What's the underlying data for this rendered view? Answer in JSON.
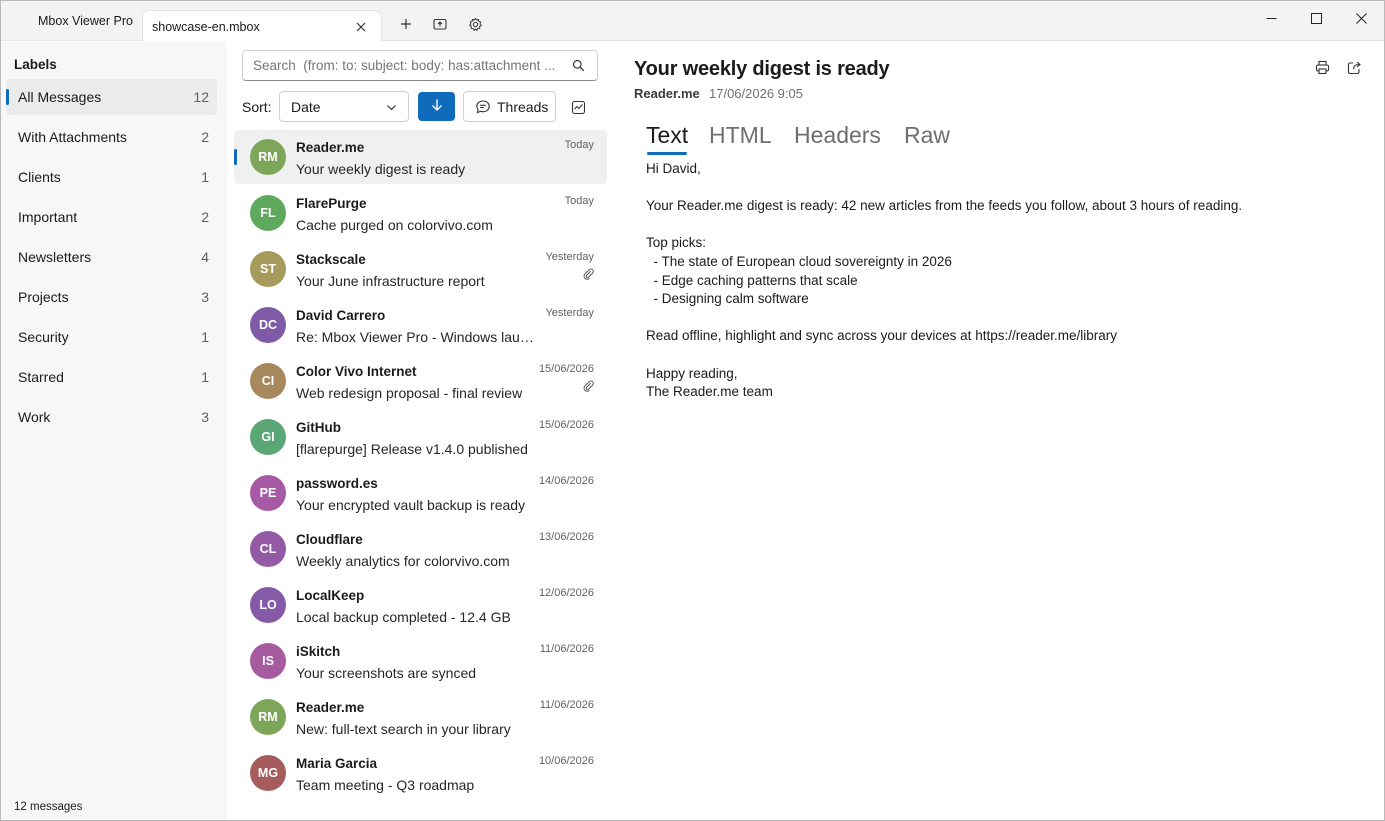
{
  "app": {
    "title": "Mbox Viewer Pro",
    "tab_name": "showcase-en.mbox"
  },
  "sidebar": {
    "heading": "Labels",
    "items": [
      {
        "label": "All Messages",
        "count": "12",
        "active": true
      },
      {
        "label": "With Attachments",
        "count": "2"
      },
      {
        "label": "Clients",
        "count": "1"
      },
      {
        "label": "Important",
        "count": "2"
      },
      {
        "label": "Newsletters",
        "count": "4"
      },
      {
        "label": "Projects",
        "count": "3"
      },
      {
        "label": "Security",
        "count": "1"
      },
      {
        "label": "Starred",
        "count": "1"
      },
      {
        "label": "Work",
        "count": "3"
      }
    ],
    "status": "12 messages"
  },
  "list": {
    "search_placeholder": "Search  (from: to: subject: body: has:attachment ...",
    "sort_label": "Sort:",
    "sort_value": "Date",
    "threads_label": "Threads",
    "messages": [
      {
        "initials": "RM",
        "color": "#7ea65a",
        "sender": "Reader.me",
        "subject": "Your weekly digest is ready",
        "date": "Today",
        "attachment": false,
        "selected": true
      },
      {
        "initials": "FL",
        "color": "#5fa95f",
        "sender": "FlarePurge",
        "subject": "Cache purged on colorvivo.com",
        "date": "Today",
        "attachment": false
      },
      {
        "initials": "ST",
        "color": "#a69a5c",
        "sender": "Stackscale",
        "subject": "Your June infrastructure report",
        "date": "Yesterday",
        "attachment": true
      },
      {
        "initials": "DC",
        "color": "#7f5aa6",
        "sender": "David Carrero",
        "subject": "Re: Mbox Viewer Pro - Windows launch",
        "date": "Yesterday",
        "attachment": false
      },
      {
        "initials": "CI",
        "color": "#a6885c",
        "sender": "Color Vivo Internet",
        "subject": "Web redesign proposal - final review",
        "date": "15/06/2026",
        "attachment": true
      },
      {
        "initials": "GI",
        "color": "#5aa674",
        "sender": "GitHub",
        "subject": "[flarepurge] Release v1.4.0 published",
        "date": "15/06/2026",
        "attachment": false
      },
      {
        "initials": "PE",
        "color": "#a65aa6",
        "sender": "password.es",
        "subject": "Your encrypted vault backup is ready",
        "date": "14/06/2026",
        "attachment": false
      },
      {
        "initials": "CL",
        "color": "#955aa6",
        "sender": "Cloudflare",
        "subject": "Weekly analytics for colorvivo.com",
        "date": "13/06/2026",
        "attachment": false
      },
      {
        "initials": "LO",
        "color": "#855aa6",
        "sender": "LocalKeep",
        "subject": "Local backup completed - 12.4 GB",
        "date": "12/06/2026",
        "attachment": false
      },
      {
        "initials": "IS",
        "color": "#a65aa0",
        "sender": "iSkitch",
        "subject": "Your screenshots are synced",
        "date": "11/06/2026",
        "attachment": false
      },
      {
        "initials": "RM",
        "color": "#7ea65a",
        "sender": "Reader.me",
        "subject": "New: full-text search in your library",
        "date": "11/06/2026",
        "attachment": false
      },
      {
        "initials": "MG",
        "color": "#a65c5c",
        "sender": "Maria Garcia",
        "subject": "Team meeting - Q3 roadmap",
        "date": "10/06/2026",
        "attachment": false
      }
    ]
  },
  "reader": {
    "subject": "Your weekly digest is ready",
    "from": "Reader.me",
    "date": "17/06/2026 9:05",
    "tabs": [
      "Text",
      "HTML",
      "Headers",
      "Raw"
    ],
    "active_tab": "Text",
    "body_lines": [
      "Hi David,",
      "",
      "Your Reader.me digest is ready: 42 new articles from the feeds you follow, about 3 hours of reading.",
      "",
      "Top picks:",
      "  - The state of European cloud sovereignty in 2026",
      "  - Edge caching patterns that scale",
      "  - Designing calm software",
      "",
      "Read offline, highlight and sync across your devices at https://reader.me/library",
      "",
      "Happy reading,",
      "The Reader.me team"
    ]
  },
  "colors": {
    "accent": "#0f6cbd",
    "sidebar_bg": "#f7f7f7",
    "titlebar_bg": "#f3f3f3"
  }
}
